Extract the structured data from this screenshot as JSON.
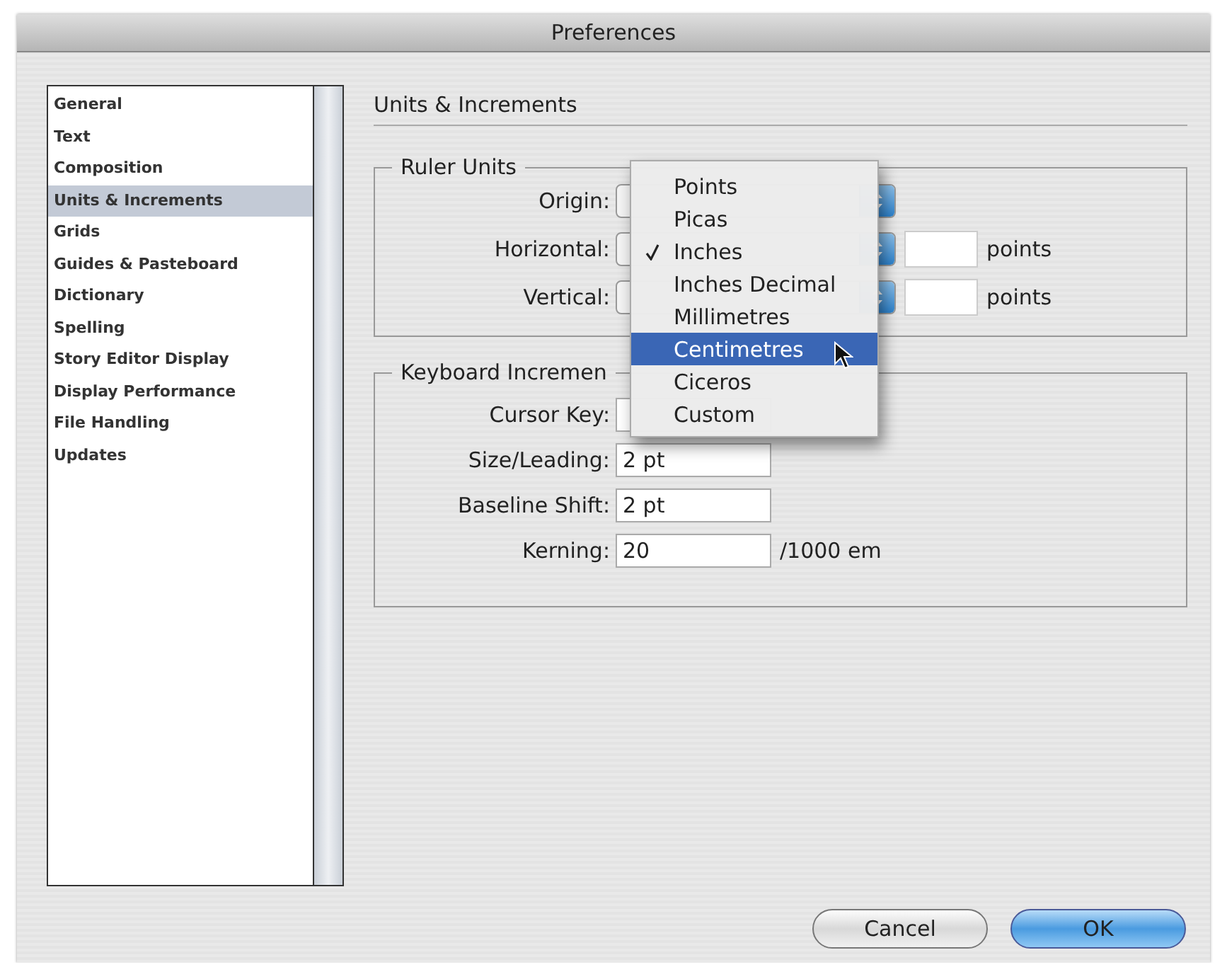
{
  "window": {
    "title": "Preferences"
  },
  "sidebar": {
    "items": [
      {
        "label": "General",
        "selected": false
      },
      {
        "label": "Text",
        "selected": false
      },
      {
        "label": "Composition",
        "selected": false
      },
      {
        "label": "Units & Increments",
        "selected": true
      },
      {
        "label": "Grids",
        "selected": false
      },
      {
        "label": "Guides & Pasteboard",
        "selected": false
      },
      {
        "label": "Dictionary",
        "selected": false
      },
      {
        "label": "Spelling",
        "selected": false
      },
      {
        "label": "Story Editor Display",
        "selected": false
      },
      {
        "label": "Display Performance",
        "selected": false
      },
      {
        "label": "File Handling",
        "selected": false
      },
      {
        "label": "Updates",
        "selected": false
      }
    ]
  },
  "panel": {
    "title": "Units & Increments",
    "ruler_units": {
      "title": "Ruler Units",
      "rows": [
        {
          "label": "Origin:"
        },
        {
          "label": "Horizontal:",
          "unit": "points"
        },
        {
          "label": "Vertical:",
          "unit": "points"
        }
      ]
    },
    "keyboard_increments": {
      "title": "Keyboard Incremen",
      "rows": [
        {
          "label": "Cursor Key:"
        },
        {
          "label": "Size/Leading:",
          "value": "2 pt"
        },
        {
          "label": "Baseline Shift:",
          "value": "2 pt"
        },
        {
          "label": "Kerning:",
          "value": "20",
          "suffix": "/1000 em"
        }
      ]
    },
    "popup_menu": {
      "items": [
        {
          "label": "Points",
          "checked": false,
          "selected": false
        },
        {
          "label": "Picas",
          "checked": false,
          "selected": false
        },
        {
          "label": "Inches",
          "checked": true,
          "selected": false
        },
        {
          "label": "Inches Decimal",
          "checked": false,
          "selected": false
        },
        {
          "label": "Millimetres",
          "checked": false,
          "selected": false
        },
        {
          "label": "Centimetres",
          "checked": false,
          "selected": true
        },
        {
          "label": "Ciceros",
          "checked": false,
          "selected": false
        },
        {
          "label": "Custom",
          "checked": false,
          "selected": false
        }
      ]
    }
  },
  "buttons": [
    {
      "label": "Cancel",
      "default": false
    },
    {
      "label": "OK",
      "default": true
    }
  ]
}
